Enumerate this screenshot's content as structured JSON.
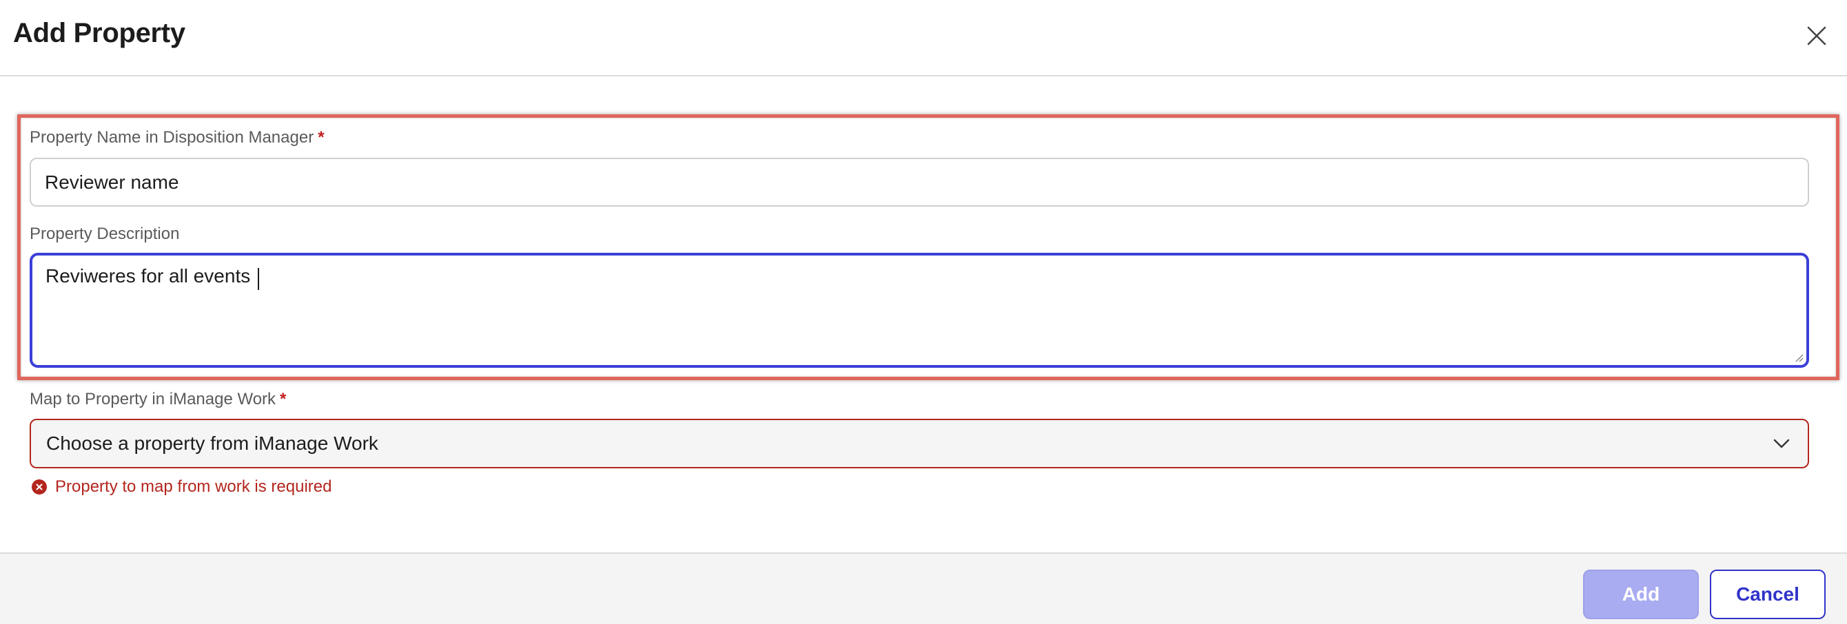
{
  "dialog": {
    "title": "Add Property",
    "close_icon": "close-icon"
  },
  "fields": {
    "property_name": {
      "label": "Property Name in Disposition Manager",
      "required_mark": "*",
      "value": "Reviewer name"
    },
    "property_description": {
      "label": "Property Description",
      "value": "Reviweres for all events"
    },
    "map_property": {
      "label": "Map to Property in iManage Work",
      "required_mark": "*",
      "placeholder": "Choose a property from iManage Work",
      "error": "Property to map from work is required",
      "chevron_icon": "chevron-down-icon",
      "error_icon": "error-circle-icon"
    }
  },
  "footer": {
    "add_label": "Add",
    "cancel_label": "Cancel"
  },
  "colors": {
    "highlight_border": "#e0665c",
    "focus_border": "#3b3fd8",
    "error": "#b3261e",
    "primary": "#3033c9",
    "primary_disabled": "#a9acf0"
  }
}
